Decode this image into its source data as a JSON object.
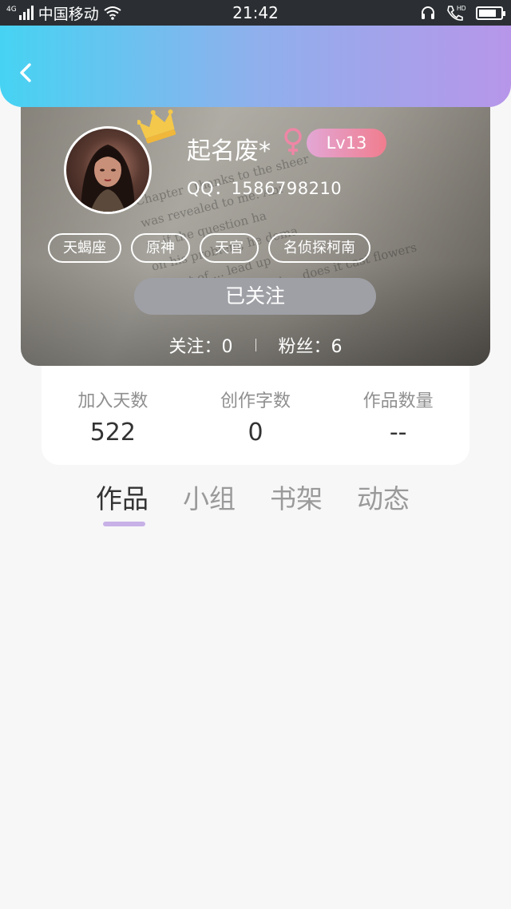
{
  "status_bar": {
    "network": "4G",
    "carrier": "中国移动",
    "time": "21:42",
    "battery_percent": 80
  },
  "header": {
    "back_icon": "chevron-left-icon"
  },
  "profile": {
    "username": "起名废*",
    "gender_icon": "female-icon",
    "level": "Lv13",
    "qq": "QQ：1586798210",
    "tags": [
      "天蝎座",
      "原神",
      "天官",
      "名侦探柯南"
    ],
    "follow_button": "已关注",
    "following": "关注：0",
    "fans": "粉丝：6"
  },
  "stats": [
    {
      "label": "加入天数",
      "value": "522"
    },
    {
      "label": "创作字数",
      "value": "0"
    },
    {
      "label": "作品数量",
      "value": "--"
    }
  ],
  "tabs": [
    "作品",
    "小组",
    "书架",
    "动态"
  ],
  "colors": {
    "header_gradient_start": "#46d3f3",
    "header_gradient_end": "#b796e9",
    "level_badge_start": "#e3a7d6",
    "level_badge_end": "#f07d8e",
    "tab_indicator": "#c7b1e6"
  }
}
